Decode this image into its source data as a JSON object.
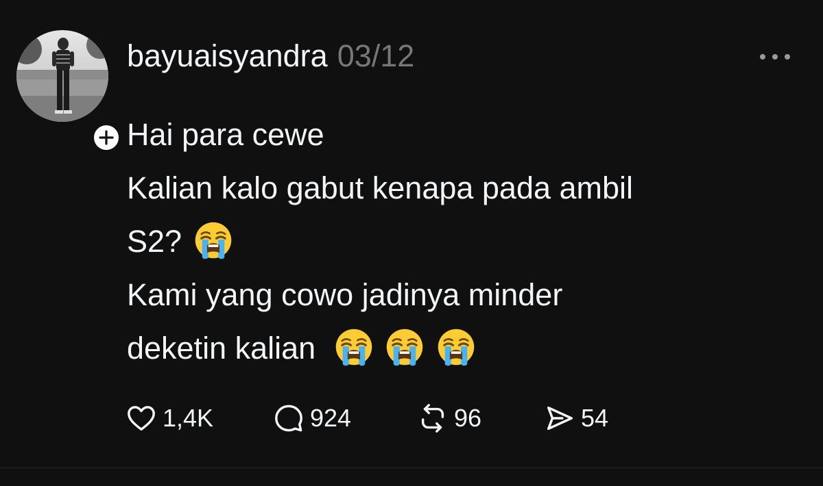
{
  "post": {
    "username": "bayuaisyandra",
    "timestamp": "03/12",
    "text_lines": [
      "Hai para cewe",
      "Kalian kalo gabut kenapa pada ambil",
      "S2?",
      "Kami yang cowo jadinya minder",
      "deketin kalian"
    ],
    "emoji": "loudly-crying-face"
  },
  "actions": {
    "likes": "1,4K",
    "replies": "924",
    "reposts": "96",
    "shares": "54"
  },
  "icons": {
    "more": "more-horizontal-icon",
    "follow": "plus-icon",
    "like": "heart-icon",
    "reply": "comment-bubble-icon",
    "repost": "repost-icon",
    "share": "send-icon"
  },
  "colors": {
    "background": "#101010",
    "text": "#f3f5f7",
    "muted": "#777777"
  }
}
